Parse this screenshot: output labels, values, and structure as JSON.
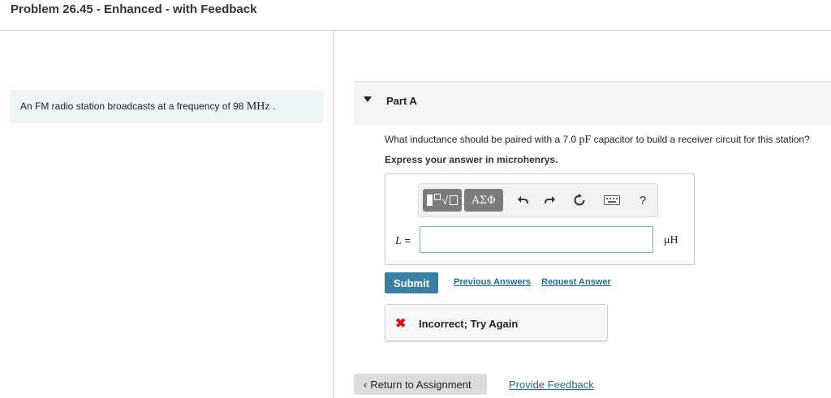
{
  "header": {
    "title": "Problem 26.45 - Enhanced - with Feedback"
  },
  "prompt": {
    "text_before": "An FM radio station broadcasts at a frequency of 98 ",
    "math": "MHz",
    "text_after": " ."
  },
  "part": {
    "label": "Part A"
  },
  "question": {
    "text_before": "What inductance should be paired with a 7.0 ",
    "math": "pF",
    "text_after": " capacitor to build a receiver circuit for this station?"
  },
  "instruction": "Express your answer in microhenrys.",
  "toolbar": {
    "templates_symbol": "√",
    "greek_label": "ΑΣΦ",
    "undo_icon": "undo-icon",
    "redo_icon": "redo-icon",
    "reset_icon": "reset-icon",
    "keyboard_icon": "keyboard-icon",
    "help_label": "?"
  },
  "answer": {
    "variable": "L",
    "equals": "=",
    "value": "",
    "unit": "μH"
  },
  "actions": {
    "submit_label": "Submit",
    "previous_answers": "Previous Answers",
    "request_answer": "Request Answer"
  },
  "feedback": {
    "symbol": "✖",
    "message": "Incorrect; Try Again"
  },
  "footer": {
    "return_label": "Return to Assignment",
    "return_chevron": "‹",
    "provide_feedback": "Provide Feedback"
  },
  "colors": {
    "accent": "#3b7ea2",
    "link": "#1f6a96",
    "error": "#cc1a1a",
    "prompt_bg": "#edf5f8"
  }
}
